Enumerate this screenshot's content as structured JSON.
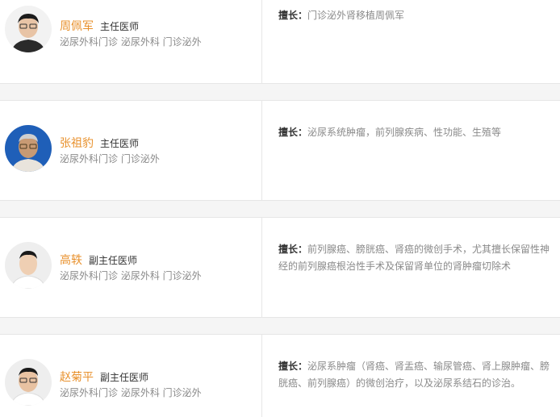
{
  "doctors": [
    {
      "name": "周佩军",
      "title": "主任医师",
      "dept": "泌尿外科门诊 泌尿外科 门诊泌外",
      "spec_label": "擅长：",
      "specialty": "门诊泌外肾移植周佩军",
      "avatar_icon": "doctor-avatar-icon"
    },
    {
      "name": "张祖豹",
      "title": "主任医师",
      "dept": "泌尿外科门诊 门诊泌外",
      "spec_label": "擅长：",
      "specialty": "泌尿系统肿瘤，前列腺疾病、性功能、生殖等",
      "avatar_icon": "doctor-avatar-icon"
    },
    {
      "name": "高轶",
      "title": "副主任医师",
      "dept": "泌尿外科门诊 泌尿外科 门诊泌外",
      "spec_label": "擅长：",
      "specialty": "前列腺癌、膀胱癌、肾癌的微创手术，尤其擅长保留性神经的前列腺癌根治性手术及保留肾单位的肾肿瘤切除术",
      "avatar_icon": "doctor-avatar-icon"
    },
    {
      "name": "赵菊平",
      "title": "副主任医师",
      "dept": "泌尿外科门诊 泌尿外科 门诊泌外",
      "spec_label": "擅长：",
      "specialty": "泌尿系肿瘤（肾癌、肾盂癌、输尿管癌、肾上腺肿瘤、膀胱癌、前列腺癌）的微创治疗，以及泌尿系结石的诊治。",
      "avatar_icon": "doctor-avatar-icon"
    }
  ],
  "colors": {
    "name": "#e8912d",
    "muted": "#8a8a8a",
    "divider": "#e6e6e6",
    "gap": "#f5f5f5"
  }
}
